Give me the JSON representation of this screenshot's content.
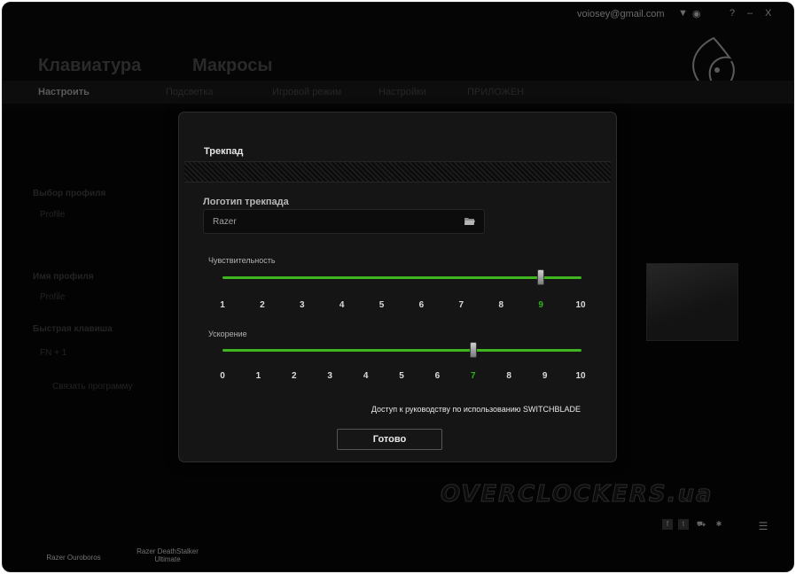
{
  "topbar": {
    "email": "voiosey@gmail.com",
    "help": "?",
    "minimize": "–",
    "close": "X"
  },
  "main_tabs": [
    "Клавиатура",
    "Макросы"
  ],
  "sub_tabs": [
    "Настроить",
    "Подсветка",
    "Игровой режим",
    "Настройки",
    "ПРИЛОЖЕН"
  ],
  "sidebar": {
    "profile_select_label": "Выбор профиля",
    "profile_select_value": "Profile",
    "profile_name_label": "Имя профиля",
    "profile_name_value": "Profile",
    "hotkey_label": "Быстрая клавиша",
    "hotkey_value": "FN + 1",
    "link_program": "Связать программу"
  },
  "devices": [
    "Razer Ouroboros",
    "Razer DeathStalker Ultimate"
  ],
  "dialog": {
    "title": "Трекпад",
    "logo_section": "Логотип трекпада",
    "logo_value": "Razer",
    "sensitivity": {
      "label": "Чувствительность",
      "ticks": [
        "1",
        "2",
        "3",
        "4",
        "5",
        "6",
        "7",
        "8",
        "9",
        "10"
      ],
      "value": 9
    },
    "acceleration": {
      "label": "Ускорение",
      "ticks": [
        "0",
        "1",
        "2",
        "3",
        "4",
        "5",
        "6",
        "7",
        "8",
        "9",
        "10"
      ],
      "value": 7
    },
    "guide_link": "Доступ к руководству по использованию SWITCHBLADE",
    "done": "Готово"
  },
  "watermark": "OVERCLOCKERS.ua",
  "colors": {
    "accent": "#3fb51f",
    "background": "#050505",
    "dialog": "#151515"
  }
}
